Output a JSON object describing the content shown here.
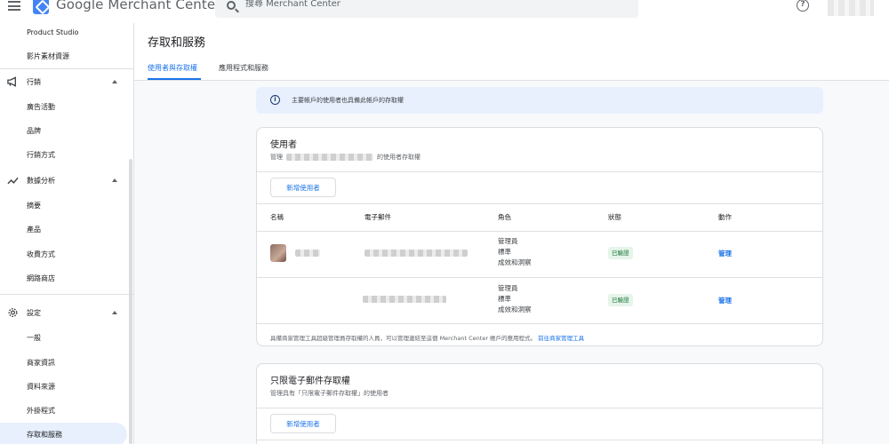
{
  "app": {
    "brand_name": "Google Merchant Center",
    "search_placeholder": "搜尋 Merchant Center",
    "help_icon": "help-circle-icon"
  },
  "sidebar": {
    "items": [
      {
        "label": "Product Studio",
        "kind": "sub"
      },
      {
        "label": "影片素材資源",
        "kind": "sub"
      },
      {
        "label": "行銷",
        "kind": "group",
        "icon": "megaphone-icon"
      },
      {
        "label": "廣告活動",
        "kind": "sub"
      },
      {
        "label": "品牌",
        "kind": "sub"
      },
      {
        "label": "行銷方式",
        "kind": "sub"
      },
      {
        "label": "數據分析",
        "kind": "group",
        "icon": "trending-up-icon"
      },
      {
        "label": "摘要",
        "kind": "sub"
      },
      {
        "label": "產品",
        "kind": "sub"
      },
      {
        "label": "收費方式",
        "kind": "sub"
      },
      {
        "label": "網路商店",
        "kind": "sub"
      },
      {
        "label": "設定",
        "kind": "group",
        "icon": "gear-icon"
      },
      {
        "label": "一般",
        "kind": "sub"
      },
      {
        "label": "商家資訊",
        "kind": "sub"
      },
      {
        "label": "資料來源",
        "kind": "sub"
      },
      {
        "label": "外掛程式",
        "kind": "sub"
      },
      {
        "label": "存取和服務",
        "kind": "sub",
        "active": true
      }
    ]
  },
  "page": {
    "title": "存取和服務",
    "tabs": [
      {
        "label": "使用者與存取權",
        "active": true
      },
      {
        "label": "應用程式和服務",
        "active": false
      }
    ],
    "info_banner": "主要帳戶的使用者也具備此帳戶的存取權"
  },
  "users_card": {
    "title": "使用者",
    "subtitle_prefix": "管理",
    "subtitle_suffix": "的使用者存取權",
    "add_button": "新增使用者",
    "columns": [
      "名稱",
      "電子郵件",
      "角色",
      "狀態",
      "動作"
    ],
    "rows": [
      {
        "roles": [
          "管理員",
          "標準",
          "成效和洞察"
        ],
        "status": "已驗證",
        "action": "管理"
      },
      {
        "roles": [
          "管理員",
          "標準",
          "成效和洞察"
        ],
        "status": "已驗證",
        "action": "管理"
      }
    ],
    "footnote_text": "具備商家管理工具超級管理員存取權的人員，可以管理連結至這個 Merchant Center 帳戶的應用程式。",
    "footnote_link": "前往商家管理工具"
  },
  "email_card": {
    "title": "只限電子郵件存取權",
    "subtitle": "管理具有「只限電子郵件存取權」的使用者",
    "add_button": "新增使用者"
  }
}
